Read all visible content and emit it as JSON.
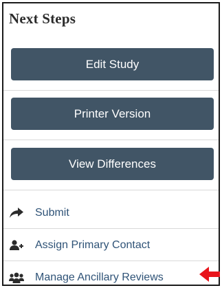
{
  "panel": {
    "title": "Next Steps"
  },
  "buttons": {
    "edit_study": "Edit Study",
    "printer_version": "Printer Version",
    "view_differences": "View Differences"
  },
  "links": [
    {
      "label": "Submit",
      "icon": "share-arrow-icon"
    },
    {
      "label": "Assign Primary Contact",
      "icon": "add-user-icon"
    },
    {
      "label": "Manage Ancillary Reviews",
      "icon": "users-group-icon"
    }
  ],
  "colors": {
    "button_bg": "#415566",
    "link_text": "#2f5377",
    "annotation_arrow": "#e8141b"
  },
  "annotation": {
    "icon": "red-pointer-arrow-icon"
  }
}
